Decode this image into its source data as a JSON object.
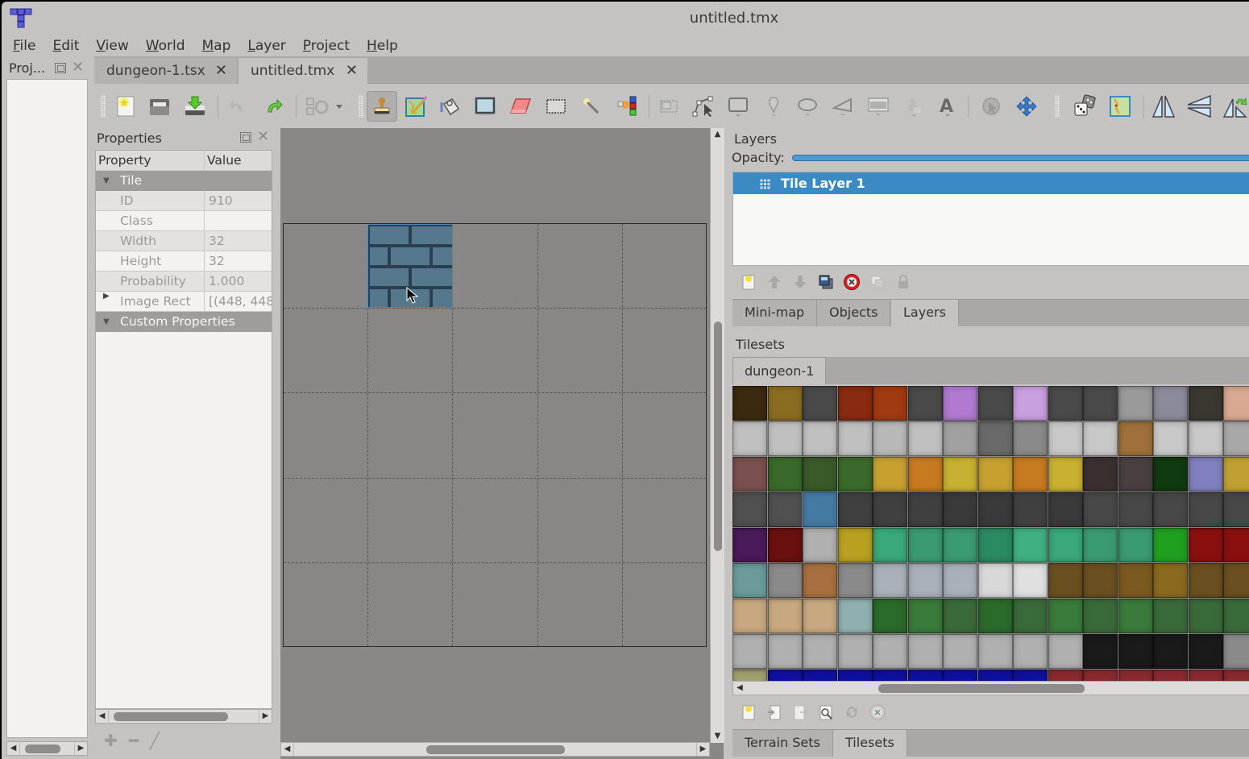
{
  "window": {
    "title": "untitled.tmx",
    "app_icon": "tiled-logo-icon"
  },
  "menu": [
    "File",
    "Edit",
    "View",
    "World",
    "Map",
    "Layer",
    "Project",
    "Help"
  ],
  "menu_mnemonics": [
    "F",
    "E",
    "V",
    "W",
    "M",
    "L",
    "P",
    "H"
  ],
  "project_panel": {
    "title": "Proj..."
  },
  "document_tabs": [
    {
      "label": "dungeon-1.tsx",
      "active": false
    },
    {
      "label": "untitled.tmx",
      "active": true
    }
  ],
  "toolbar": {
    "buttons": [
      "new-icon",
      "open-icon",
      "save-icon",
      "undo-icon",
      "redo-icon",
      "commands-icon",
      "stamp-brush-icon",
      "terrain-brush-icon",
      "bucket-fill-icon",
      "shape-fill-icon",
      "eraser-icon",
      "rectangular-select-icon",
      "magic-wand-icon",
      "select-same-tile-icon",
      "select-objects-icon",
      "edit-polygons-icon",
      "insert-rectangle-icon",
      "insert-point-icon",
      "insert-ellipse-icon",
      "insert-polygon-icon",
      "insert-tile-icon",
      "insert-template-icon",
      "insert-text-icon",
      "world-tool-icon",
      "move-icon",
      "random-mode-icon",
      "wang-fill-icon",
      "flip-horizontal-icon",
      "flip-vertical-icon",
      "rotate-icon"
    ],
    "checked": "stamp-brush-icon"
  },
  "properties": {
    "title": "Properties",
    "columns": [
      "Property",
      "Value"
    ],
    "groups": [
      {
        "name": "Tile",
        "rows": [
          {
            "key": "ID",
            "value": "910"
          },
          {
            "key": "Class",
            "value": ""
          },
          {
            "key": "Width",
            "value": "32"
          },
          {
            "key": "Height",
            "value": "32"
          },
          {
            "key": "Probability",
            "value": "1.000"
          },
          {
            "key": "Image Rect",
            "value": "[(448, 448",
            "expandable": true
          }
        ]
      },
      {
        "name": "Custom Properties",
        "rows": []
      }
    ],
    "actions": [
      "add-property-icon",
      "remove-property-icon",
      "rename-property-icon"
    ]
  },
  "map": {
    "columns": 5,
    "rows": 5,
    "placed_tiles": [
      {
        "col": 1,
        "row": 0,
        "tile_id": 910
      }
    ]
  },
  "layers": {
    "title": "Layers",
    "opacity_label": "Opacity:",
    "opacity": 1.0,
    "items": [
      {
        "name": "Tile Layer 1",
        "type": "tile-layer",
        "selected": true
      }
    ],
    "actions": [
      "new-layer-icon",
      "raise-layer-icon",
      "lower-layer-icon",
      "duplicate-layer-icon",
      "remove-layer-icon",
      "toggle-other-layers-icon",
      "lock-layer-icon"
    ]
  },
  "right_tabs_top": [
    {
      "label": "Mini-map",
      "active": false
    },
    {
      "label": "Objects",
      "active": false
    },
    {
      "label": "Layers",
      "active": true
    }
  ],
  "tilesets": {
    "title": "Tilesets",
    "tabs": [
      {
        "label": "dungeon-1",
        "active": true
      }
    ],
    "actions": [
      "new-tileset-icon",
      "embed-tileset-icon",
      "export-tileset-icon",
      "edit-tileset-icon",
      "reload-tileset-icon",
      "remove-tileset-icon"
    ]
  },
  "right_tabs_bottom": [
    {
      "label": "Terrain Sets",
      "active": false
    },
    {
      "label": "Tilesets",
      "active": true
    }
  ],
  "tile_palette_rows": [
    [
      "#3b2a10",
      "#8a6d20",
      "#4a4a4a",
      "#8a2a10",
      "#a03a10",
      "#4a4a4a",
      "#b07ad0",
      "#4a4a4a",
      "#c8a0e0",
      "#4a4a4a",
      "#4a4a4a",
      "#9a9a9a",
      "#8a8a9a",
      "#3a3830",
      "#d8a890"
    ],
    [
      "#c0c0c0",
      "#c0c0c0",
      "#c0c0c0",
      "#c0c0c0",
      "#b8b8b8",
      "#c0c0c0",
      "#a0a0a0",
      "#6a6a6a",
      "#8a8a8a",
      "#c8c8c8",
      "#c8c8c8",
      "#a0703a",
      "#c8c8c8",
      "#c8c8c8",
      "#a8a8a8"
    ],
    [
      "#7a5050",
      "#3a6a2a",
      "#3a5a2a",
      "#3a6a2a",
      "#c8a030",
      "#c87a20",
      "#c8b030",
      "#c8a030",
      "#c87a20",
      "#c8b030",
      "#3a3030",
      "#4a4040",
      "#103a10",
      "#8080c0",
      "#c0a030"
    ],
    [
      "#505050",
      "#505050",
      "#3a7aa8",
      "#404040",
      "#404040",
      "#404040",
      "#3a3a3a",
      "#3a3a3a",
      "#404040",
      "#3a3a3a",
      "#484848",
      "#484848",
      "#484848",
      "#484848",
      "#484848"
    ],
    [
      "#4a1a5a",
      "#6a1010",
      "#b0b0b0",
      "#b8a020",
      "#3aa878",
      "#3a9a70",
      "#3a9a70",
      "#2a8a60",
      "#40b080",
      "#3aa878",
      "#3a9a70",
      "#3a9a70",
      "#20a020",
      "#8a1010",
      "#8a1010"
    ],
    [
      "#6a9a9a",
      "#8a8a8a",
      "#a87040",
      "#8a8a8a",
      "#a8b0b8",
      "#a8b0b8",
      "#a8b0b8",
      "#d8d8d8",
      "#e0e0e0",
      "#6a5020",
      "#6a5020",
      "#7a5a20",
      "#8a6a20",
      "#6a5020",
      "#6a5020"
    ],
    [
      "#c8a880",
      "#c8a880",
      "#c8a880",
      "#90b0b0",
      "#2a6a2a",
      "#3a7a3a",
      "#3a6a3a",
      "#2a6a2a",
      "#3a6a3a",
      "#3a7a3a",
      "#3a6a3a",
      "#3a7a3a",
      "#3a6a3a",
      "#3a6a3a",
      "#3a6a3a"
    ],
    [
      "#b0b0b0",
      "#b0b0b0",
      "#b0b0b0",
      "#b0b0b0",
      "#b0b0b0",
      "#b0b0b0",
      "#b0b0b0",
      "#b0b0b0",
      "#b0b0b0",
      "#b0b0b0",
      "#1a1a1a",
      "#1a1a1a",
      "#1a1a1a",
      "#1a1a1a",
      "#8a8a8a"
    ],
    [
      "#a0a070",
      "#1010a0",
      "#1010a0",
      "#1010a0",
      "#1010a0",
      "#1010a0",
      "#1010a0",
      "#1010a0",
      "#1010a0",
      "#8a2a30",
      "#8a2a30",
      "#8a2a30",
      "#8a2a30",
      "#8a2a30",
      "#8a2a30"
    ]
  ],
  "tile_palette_selected": {
    "row": 3,
    "col": 2
  },
  "colors": {
    "accent": "#3b8ac4",
    "window_bg": "#c4c3c1",
    "canvas_bg": "#888786"
  }
}
